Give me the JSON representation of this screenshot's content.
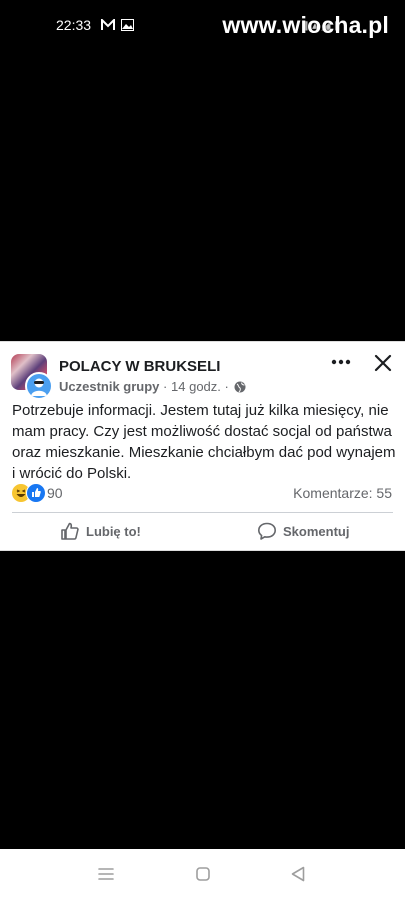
{
  "status_bar": {
    "time": "22:33",
    "icons_left": [
      "mail-icon",
      "gallery-icon"
    ],
    "watermark": "www.wiocha.pl"
  },
  "post": {
    "group_name": "POLACY W BRUKSELI",
    "author_role": "Uczestnik grupy",
    "separator": "·",
    "time_ago": "14 godz.",
    "text": "Potrzebuje informacji. Jestem tutaj już kilka miesięcy, nie mam pracy. Czy jest możliwość dostać socjal od państwa oraz mieszkanie. Mieszkanie chciałbym dać pod wynajem i wrócić do Polski.",
    "reactions_count": "90",
    "reaction_types": [
      "haha",
      "like"
    ],
    "comments_label": "Komentarze: 55",
    "like_label": "Lubię to!",
    "comment_label": "Skomentuj"
  },
  "nav_bar": {
    "buttons": [
      "menu-icon",
      "home-icon",
      "back-icon"
    ]
  },
  "colors": {
    "background": "#000000",
    "card": "#ffffff",
    "text": "#1c1e21",
    "muted": "#65676b",
    "like_blue": "#1877f2",
    "haha_yellow": "#f7c531"
  }
}
